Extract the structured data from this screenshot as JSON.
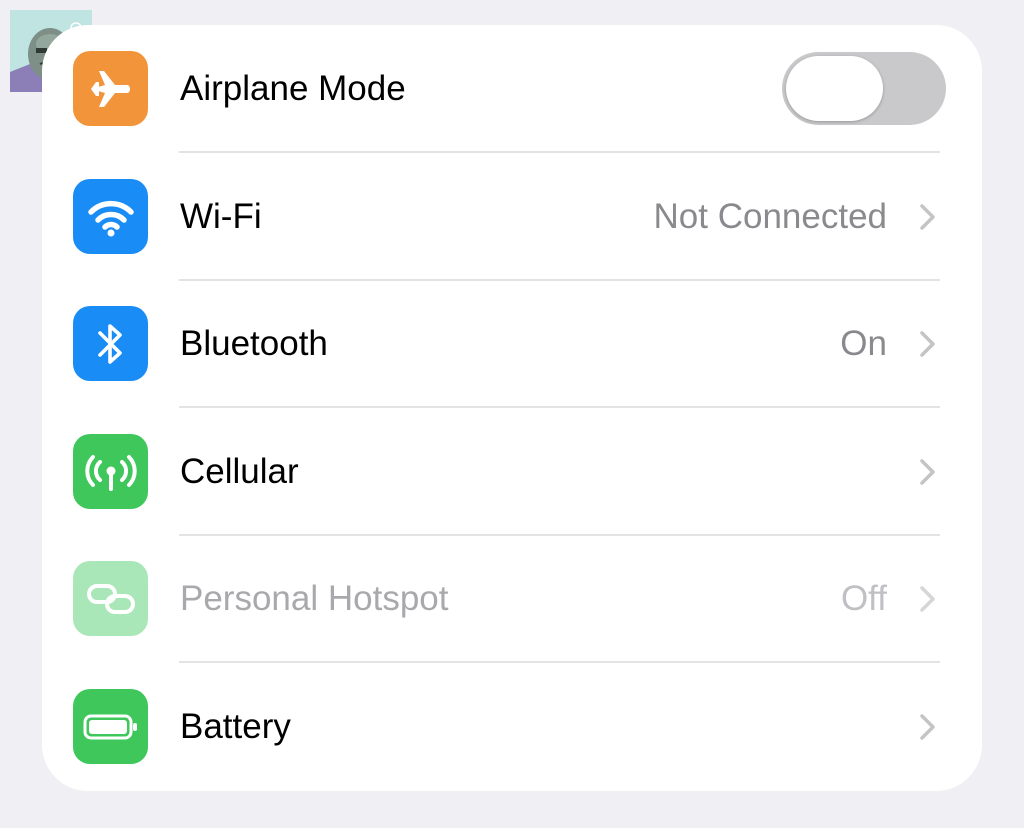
{
  "settings": {
    "rows": [
      {
        "label": "Airplane Mode",
        "value": "",
        "icon": "airplane-icon",
        "icon_color": "#f2943a",
        "type": "toggle",
        "toggle_on": false
      },
      {
        "label": "Wi-Fi",
        "value": "Not Connected",
        "icon": "wifi-icon",
        "icon_color": "#1a8cf5",
        "type": "link"
      },
      {
        "label": "Bluetooth",
        "value": "On",
        "icon": "bluetooth-icon",
        "icon_color": "#1a8cf5",
        "type": "link"
      },
      {
        "label": "Cellular",
        "value": "",
        "icon": "cellular-antenna-icon",
        "icon_color": "#3fc75c",
        "type": "link"
      },
      {
        "label": "Personal Hotspot",
        "value": "Off",
        "icon": "personal-hotspot-icon",
        "icon_color": "#a9e6b8",
        "type": "link",
        "disabled": true
      },
      {
        "label": "Battery",
        "value": "",
        "icon": "battery-icon",
        "icon_color": "#3fc75c",
        "type": "link"
      }
    ]
  },
  "colors": {
    "background": "#efeff4",
    "card": "#ffffff",
    "toggle_off": "#c9c9cc",
    "secondary_text": "#8a8a8e"
  }
}
